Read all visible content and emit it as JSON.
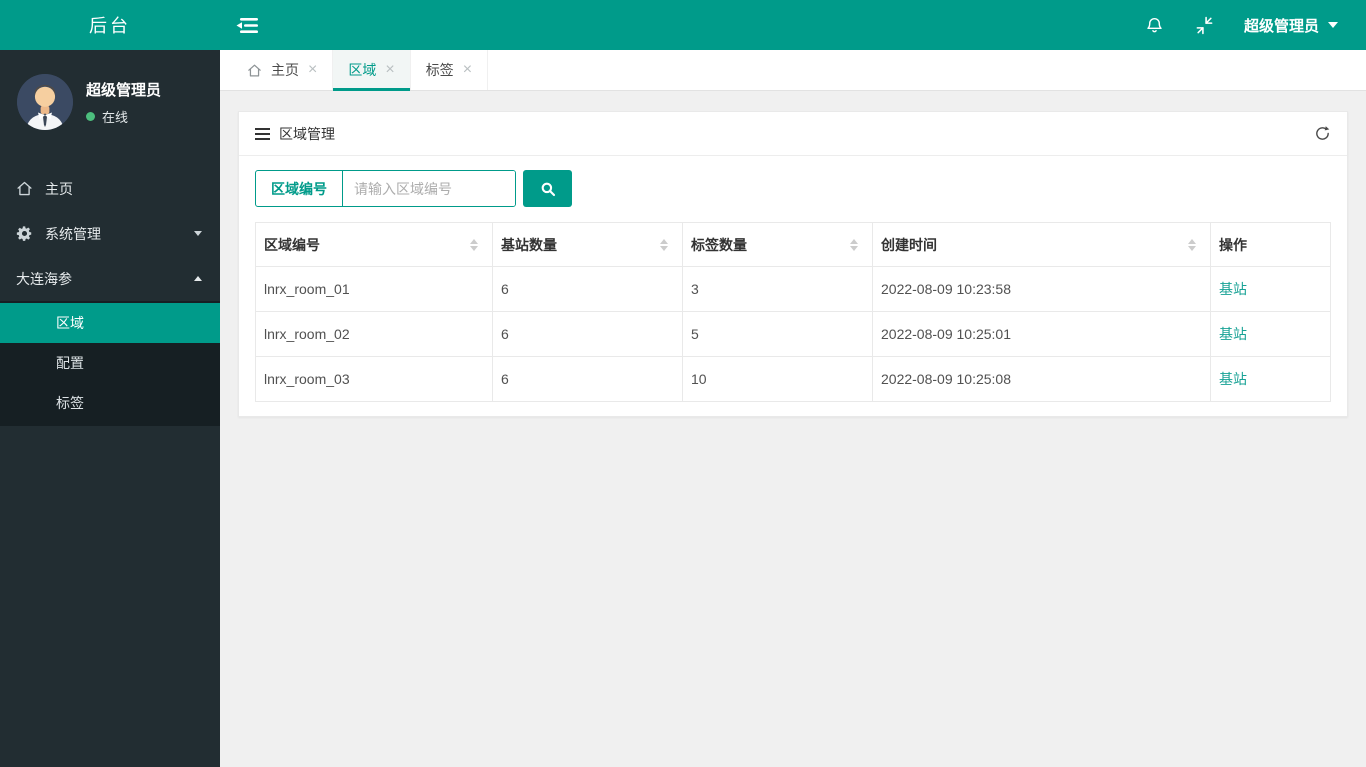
{
  "brand": {
    "title": "后台"
  },
  "topbar": {
    "user_menu_label": "超级管理员"
  },
  "icons": {
    "close_glyph": "×"
  },
  "colors": {
    "accent": "#009b8a",
    "sidebar_bg": "#222d32",
    "submenu_bg": "#161f23",
    "content_bg": "#f0f0f0",
    "status_green": "#4cbe7d",
    "link_teal": "#17a295"
  },
  "sidebar": {
    "user": {
      "name": "超级管理员",
      "status": "在线"
    },
    "menu": [
      {
        "label": "主页",
        "icon": "home-icon"
      },
      {
        "label": "系统管理",
        "icon": "gear-icon",
        "caret": "down"
      },
      {
        "label": "大连海参",
        "caret": "up",
        "expanded": true
      }
    ],
    "submenu": [
      {
        "label": "区域",
        "active": true
      },
      {
        "label": "配置",
        "active": false
      },
      {
        "label": "标签",
        "active": false
      }
    ]
  },
  "tabs": [
    {
      "label": "主页",
      "icon": "home-icon",
      "active": false
    },
    {
      "label": "区域",
      "active": true
    },
    {
      "label": "标签",
      "active": false
    }
  ],
  "panel": {
    "title": "区域管理",
    "search": {
      "field_label": "区域编号",
      "placeholder": "请输入区域编号",
      "value": ""
    },
    "table": {
      "columns": [
        {
          "label": "区域编号",
          "sortable": true
        },
        {
          "label": "基站数量",
          "sortable": true
        },
        {
          "label": "标签数量",
          "sortable": true
        },
        {
          "label": "创建时间",
          "sortable": true
        },
        {
          "label": "操作",
          "sortable": false
        }
      ],
      "rows": [
        {
          "area_id": "lnrx_room_01",
          "base_station_count": "6",
          "tag_count": "3",
          "created_at": "2022-08-09 10:23:58",
          "action": "基站"
        },
        {
          "area_id": "lnrx_room_02",
          "base_station_count": "6",
          "tag_count": "5",
          "created_at": "2022-08-09 10:25:01",
          "action": "基站"
        },
        {
          "area_id": "lnrx_room_03",
          "base_station_count": "6",
          "tag_count": "10",
          "created_at": "2022-08-09 10:25:08",
          "action": "基站"
        }
      ]
    }
  }
}
